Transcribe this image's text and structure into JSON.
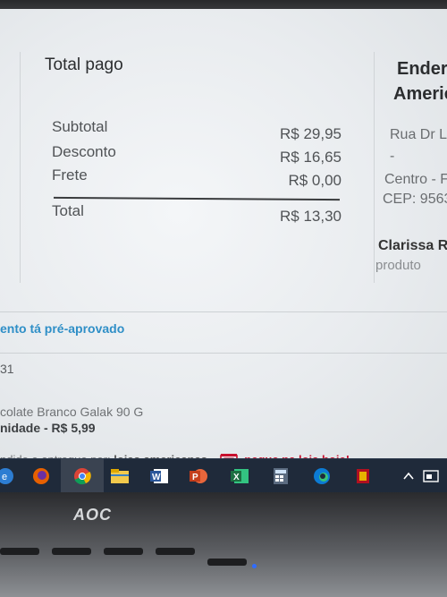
{
  "summary": {
    "title": "Total pago",
    "rows": [
      {
        "label": "Subtotal",
        "value": "R$ 29,95"
      },
      {
        "label": "Desconto",
        "value": "R$ 16,65"
      },
      {
        "label": "Frete",
        "value": "R$ 0,00"
      }
    ],
    "total": {
      "label": "Total",
      "value": "R$ 13,30"
    }
  },
  "address": {
    "title_line1": "Ender",
    "title_line2": "Americ",
    "street": "Rua Dr L",
    "dash": "-",
    "district": "Centro - F",
    "zip": "CEP: 9563",
    "recipient": "Clarissa R",
    "note": "produto"
  },
  "credit_banner": "ento tá pré-aprovado",
  "order_number": "31",
  "item": {
    "name": "colate Branco Galak 90 G",
    "unit_price": "nidade - R$ 5,99"
  },
  "fulfillment": {
    "prefix": "ndido e entregue por:",
    "seller": "lojas americanas",
    "pickup_label": "pegue na loja",
    "pickup_when": "hoje!"
  },
  "taskbar": {
    "icons": [
      "edge-legacy-icon",
      "firefox-icon",
      "chrome-icon",
      "file-explorer-icon",
      "word-icon",
      "powerpoint-icon",
      "excel-icon",
      "calculator-icon",
      "edge-icon",
      "app-icon"
    ],
    "accent": "#1f2a3a"
  },
  "monitor": {
    "brand": "AOC"
  },
  "colors": {
    "pickup_red": "#c8102e",
    "link_blue": "#2f8fc7"
  }
}
